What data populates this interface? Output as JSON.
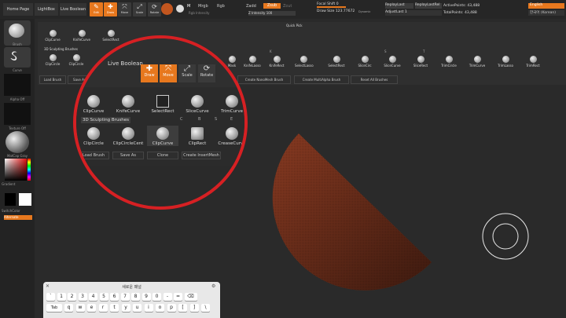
{
  "tabs": {
    "home": "Home Page",
    "lightbox": "LightBox",
    "live_boolean": "Live Boolean"
  },
  "tools": {
    "edit": "Edit",
    "draw": "Draw",
    "move": "Move",
    "scale": "Scale",
    "rotate": "Rotate"
  },
  "material": {
    "mrgb": "Mrgb",
    "rgb": "Rgb",
    "m": "M",
    "zadd": "Zadd",
    "zsub": "Zsub",
    "zcut": "Zcut",
    "rgb_intensity": "Rgb Intensity",
    "z_intensity": "Z Intensity 100"
  },
  "focal": {
    "focal_shift": "Focal Shift 0",
    "draw_size": "Draw Size 123.77672",
    "dynamic": "Dynamic"
  },
  "replay": {
    "replay_last": "ReplayLast",
    "replay_last_rel": "ReplayLastRel",
    "adjust_last": "AdjustLast 1"
  },
  "points": {
    "active": "ActivePoints: 43,488",
    "total": "TotalPoints: 43,488"
  },
  "lang": {
    "english": "English",
    "korean": "한국어 (Korean)"
  },
  "left": {
    "brush": "Brush",
    "curve": "Curve",
    "alpha": "Alpha Off",
    "texture": "Texture Off",
    "matcap": "MatCap Gray",
    "gradient": "Gradient",
    "switch_color": "SwitchColor",
    "alternate": "Alternate"
  },
  "quickpick": {
    "title": "Quick Pick",
    "clipcurve": "ClipCurve",
    "knifecurve": "KnifeCurve",
    "selectrect": "SelectRect",
    "sculpt_label": "3D Sculpting Brushes",
    "clipcircle": "ClipCircle",
    "clipcircle2": "ClipCircle",
    "live_boolean": "Live Boolean"
  },
  "shelf_row": {
    "mask": "Mask",
    "knifelasso": "KnifeLasso",
    "knifefront": "KnifeRect",
    "selectlasso": "SelectLasso",
    "selectrect": "SelectRect",
    "slicecirc": "SliceCirc",
    "slicecurve": "SliceCurve",
    "slicerect": "SliceRect",
    "trimcircle": "TrimCircle",
    "trimcurve": "TrimCurve",
    "trimlasso": "TrimLasso",
    "trimrect": "TrimRect"
  },
  "keyrow": [
    "K",
    "S",
    "T"
  ],
  "actions": {
    "load": "Load Brush",
    "save": "Save As",
    "clone": "Clone",
    "insert": "Create InsertMesh",
    "nanomesh": "Create NanoMesh Brush",
    "multialpha": "Create MultiAlpha Brush",
    "reset": "Reset All Brushes"
  },
  "magnified": {
    "tools": {
      "draw": "Draw",
      "move": "Move",
      "scale": "Scale",
      "rotate": "Rotate"
    },
    "live_boolean": "Live Boolean",
    "row1": {
      "clipcurve": "ClipCurve",
      "knifecurve": "KnifeCurve",
      "selectrect": "SelectRect",
      "slicecurve": "SliceCurve",
      "trimcurve": "TrimCurve"
    },
    "sculpt_label": "3D Sculpting Brushes",
    "row2": {
      "clipcircle": "ClipCircle",
      "clipcirclecenter": "ClipCircleCent",
      "clipcurve": "ClipCurve",
      "cliprect": "ClipRect",
      "creasecurve": "CreaseCurve"
    },
    "row2_keys": [
      "C",
      "B",
      "S",
      "E"
    ],
    "actions": {
      "load": "Load Brush",
      "save": "Save As",
      "clone": "Clone",
      "insert": "Create InsertMesh"
    }
  },
  "keyboard": {
    "title": "새로운 패널",
    "row1": [
      "`",
      "1",
      "2",
      "3",
      "4",
      "5",
      "6",
      "7",
      "8",
      "9",
      "0",
      "-",
      "="
    ],
    "tab": "Tab",
    "row2": [
      "q",
      "w",
      "e",
      "r",
      "t",
      "y",
      "u",
      "i",
      "o",
      "p",
      "[",
      "]",
      "\\"
    ]
  },
  "colors": {
    "accent": "#e7781e",
    "ring": "#d62023",
    "mesh": "#8a3b22"
  }
}
